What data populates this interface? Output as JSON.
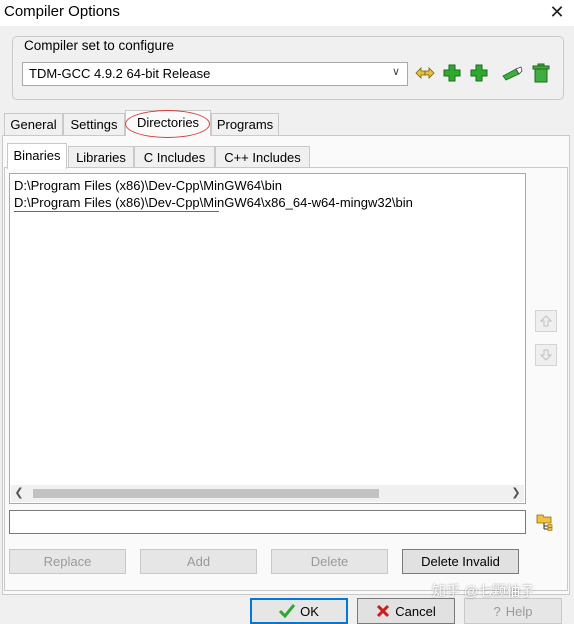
{
  "window": {
    "title": "Compiler Options",
    "close_glyph": "✕"
  },
  "compiler_set": {
    "label": "Compiler set to configure",
    "selected": "TDM-GCC 4.9.2 64-bit Release",
    "toolbar_icons": [
      "find-compilers-icon",
      "add-compiler-icon",
      "add-compiler-folder-icon",
      "rename-icon",
      "delete-compiler-icon"
    ]
  },
  "tabs": [
    "General",
    "Settings",
    "Directories",
    "Programs"
  ],
  "active_tab": "Directories",
  "subtabs": [
    "Binaries",
    "Libraries",
    "C Includes",
    "C++ Includes"
  ],
  "active_subtab": "Binaries",
  "directories": [
    "D:\\Program Files (x86)\\Dev-Cpp\\MinGW64\\bin",
    "D:\\Program Files (x86)\\Dev-Cpp\\MinGW64\\x86_64-w64-mingw32\\bin"
  ],
  "path_input": {
    "value": ""
  },
  "actions": {
    "replace": "Replace",
    "add": "Add",
    "delete": "Delete",
    "delete_invalid": "Delete Invalid"
  },
  "footer": {
    "ok": "OK",
    "cancel": "Cancel",
    "help": "Help"
  },
  "watermark": "知乎 @七颗柚子",
  "colors": {
    "annotation_red": "#d23c3c",
    "focus_blue": "#0078d7",
    "icon_green": "#2fa82f"
  }
}
